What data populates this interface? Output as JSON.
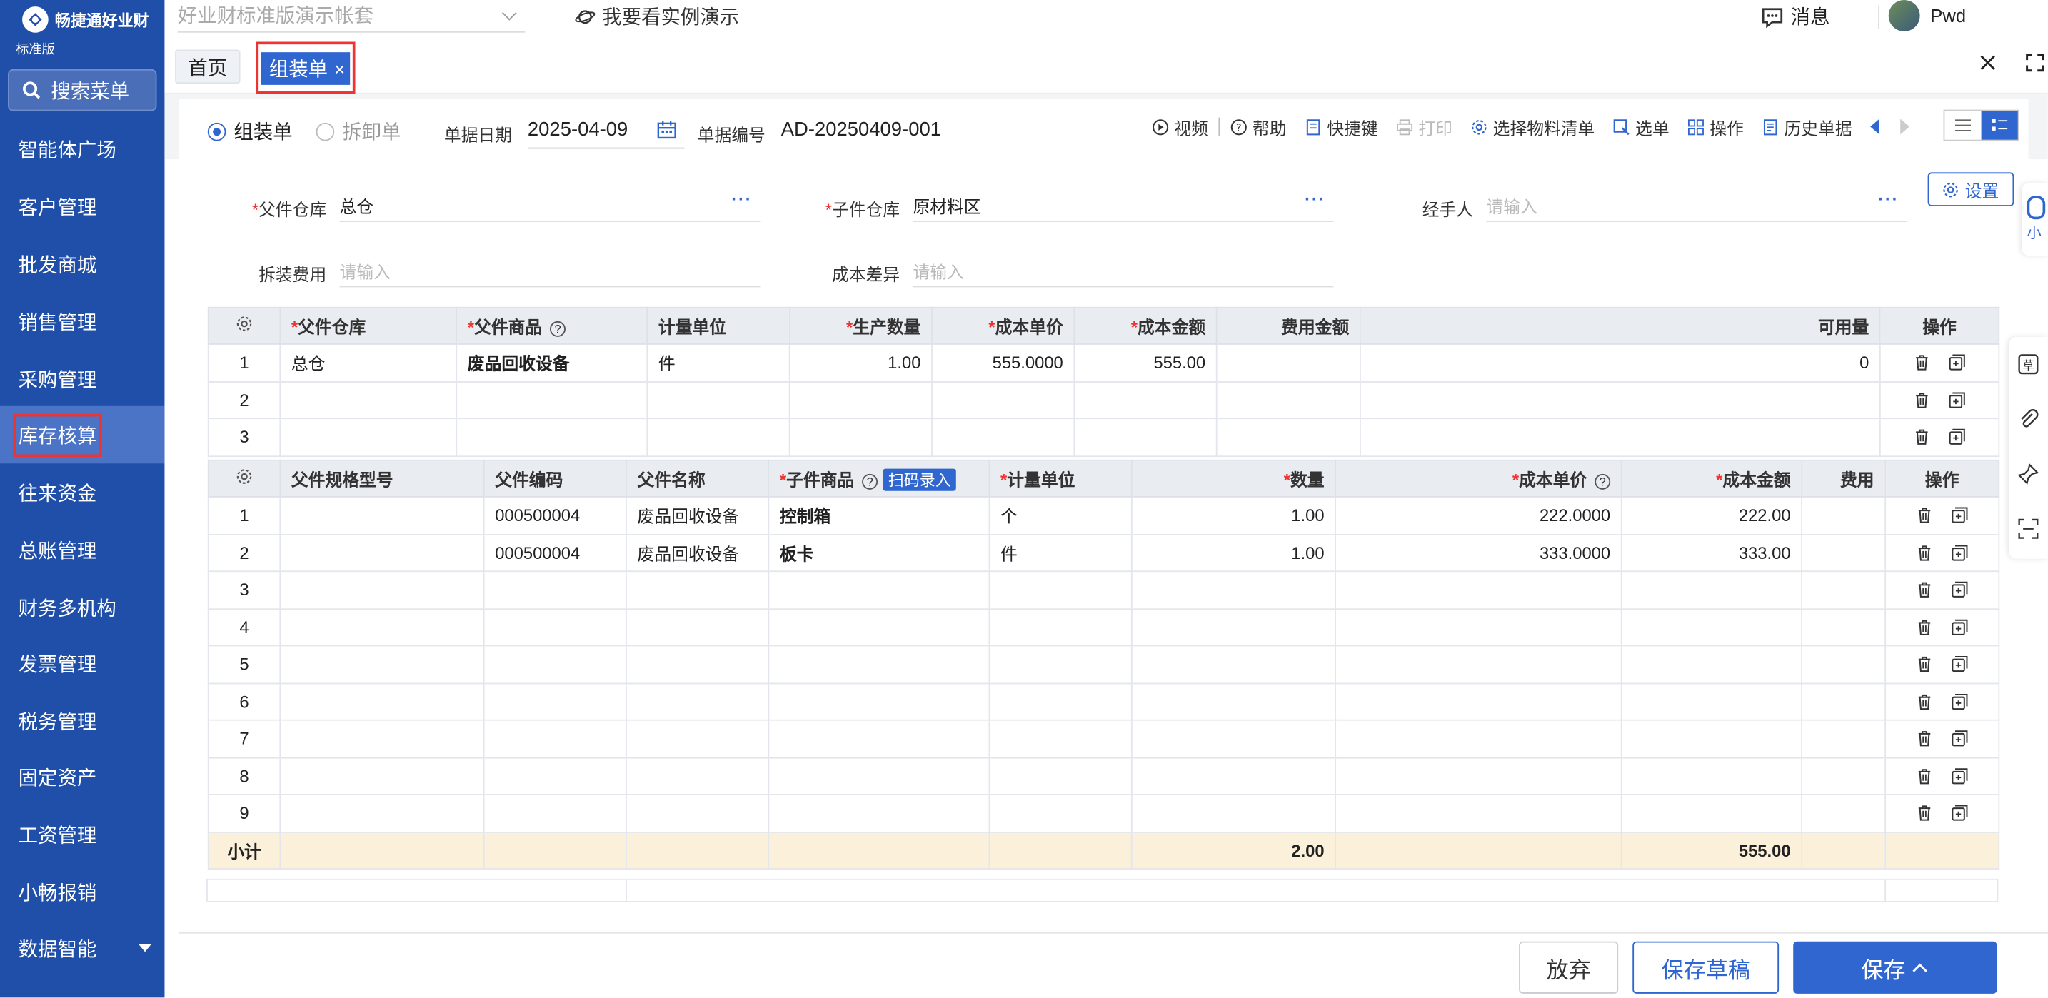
{
  "sidebar": {
    "brand": "畅捷通好业财",
    "edition": "标准版",
    "search_label": "搜索菜单",
    "items": [
      {
        "label": "智能体广场"
      },
      {
        "label": "客户管理"
      },
      {
        "label": "批发商城"
      },
      {
        "label": "销售管理"
      },
      {
        "label": "采购管理"
      },
      {
        "label": "库存核算"
      },
      {
        "label": "往来资金"
      },
      {
        "label": "总账管理"
      },
      {
        "label": "财务多机构"
      },
      {
        "label": "发票管理"
      },
      {
        "label": "税务管理"
      },
      {
        "label": "固定资产"
      },
      {
        "label": "工资管理"
      },
      {
        "label": "小畅报销"
      },
      {
        "label": "数据智能"
      }
    ]
  },
  "topbar": {
    "account": "好业财标准版演示帐套",
    "demo": "我要看实例演示",
    "messages": "消息",
    "user": "Pwd"
  },
  "tabs": {
    "home": "首页",
    "active": "组装单",
    "active_close": "×"
  },
  "doc": {
    "mode_assemble": "组装单",
    "mode_disassemble": "拆卸单",
    "date_label": "单据日期",
    "date_value": "2025-04-09",
    "number_label": "单据编号",
    "number_value": "AD-20250409-001"
  },
  "toolbar": {
    "video": "视频",
    "help": "帮助",
    "shortcuts": "快捷键",
    "print": "打印",
    "select_bom": "选择物料清单",
    "select_doc": "选单",
    "operate": "操作",
    "history": "历史单据"
  },
  "settings_label": "设置",
  "form": {
    "parent_wh_label": "父件仓库",
    "parent_wh_value": "总仓",
    "child_wh_label": "子件仓库",
    "child_wh_value": "原材料区",
    "handler_label": "经手人",
    "handler_placeholder": "请输入",
    "fee_label": "拆装费用",
    "fee_placeholder": "请输入",
    "diff_label": "成本差异",
    "diff_placeholder": "请输入",
    "dots": "···"
  },
  "parent_table": {
    "headers": {
      "wh": "父件仓库",
      "product": "父件商品",
      "unit": "计量单位",
      "qty": "生产数量",
      "unit_cost": "成本单价",
      "amount": "成本金额",
      "fee": "费用金额",
      "available": "可用量",
      "ops": "操作"
    },
    "rows": [
      {
        "no": "1",
        "wh": "总仓",
        "product": "废品回收设备",
        "unit": "件",
        "qty": "1.00",
        "unit_cost": "555.0000",
        "amount": "555.00",
        "fee": "",
        "available": "0"
      },
      {
        "no": "2",
        "wh": "",
        "product": "",
        "unit": "",
        "qty": "",
        "unit_cost": "",
        "amount": "",
        "fee": "",
        "available": ""
      },
      {
        "no": "3",
        "wh": "",
        "product": "",
        "unit": "",
        "qty": "",
        "unit_cost": "",
        "amount": "",
        "fee": "",
        "available": ""
      }
    ]
  },
  "child_table": {
    "headers": {
      "spec": "父件规格型号",
      "code": "父件编码",
      "name": "父件名称",
      "product": "子件商品",
      "scan": "扫码录入",
      "unit": "计量单位",
      "qty": "数量",
      "unit_cost": "成本单价",
      "amount": "成本金额",
      "fee": "费用",
      "ops": "操作"
    },
    "rows": [
      {
        "no": "1",
        "spec": "",
        "code": "000500004",
        "name": "废品回收设备",
        "product": "控制箱",
        "unit": "个",
        "qty": "1.00",
        "unit_cost": "222.0000",
        "amount": "222.00"
      },
      {
        "no": "2",
        "spec": "",
        "code": "000500004",
        "name": "废品回收设备",
        "product": "板卡",
        "unit": "件",
        "qty": "1.00",
        "unit_cost": "333.0000",
        "amount": "333.00"
      },
      {
        "no": "3",
        "spec": "",
        "code": "",
        "name": "",
        "product": "",
        "unit": "",
        "qty": "",
        "unit_cost": "",
        "amount": ""
      },
      {
        "no": "4",
        "spec": "",
        "code": "",
        "name": "",
        "product": "",
        "unit": "",
        "qty": "",
        "unit_cost": "",
        "amount": ""
      },
      {
        "no": "5",
        "spec": "",
        "code": "",
        "name": "",
        "product": "",
        "unit": "",
        "qty": "",
        "unit_cost": "",
        "amount": ""
      },
      {
        "no": "6",
        "spec": "",
        "code": "",
        "name": "",
        "product": "",
        "unit": "",
        "qty": "",
        "unit_cost": "",
        "amount": ""
      },
      {
        "no": "7",
        "spec": "",
        "code": "",
        "name": "",
        "product": "",
        "unit": "",
        "qty": "",
        "unit_cost": "",
        "amount": ""
      },
      {
        "no": "8",
        "spec": "",
        "code": "",
        "name": "",
        "product": "",
        "unit": "",
        "qty": "",
        "unit_cost": "",
        "amount": ""
      },
      {
        "no": "9",
        "spec": "",
        "code": "",
        "name": "",
        "product": "",
        "unit": "",
        "qty": "",
        "unit_cost": "",
        "amount": ""
      }
    ],
    "subtotal": {
      "label": "小计",
      "qty": "2.00",
      "amount": "555.00"
    }
  },
  "footer": {
    "abandon": "放弃",
    "save_draft": "保存草稿",
    "save": "保存"
  },
  "side_peek": "小"
}
